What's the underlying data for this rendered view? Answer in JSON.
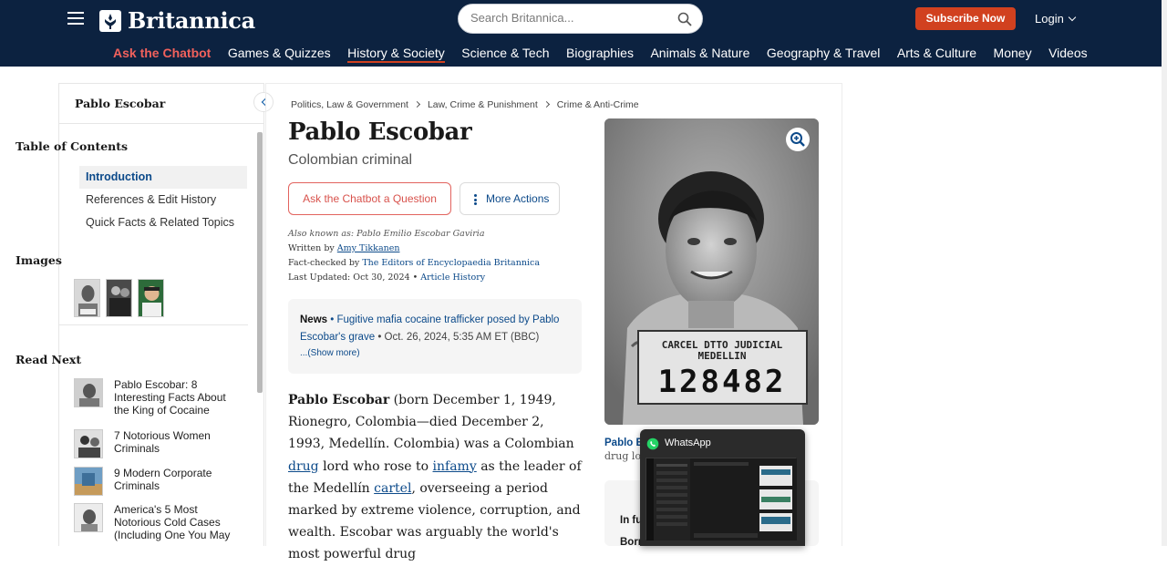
{
  "header": {
    "logo_text": "Britannica",
    "search_placeholder": "Search Britannica...",
    "subscribe_label": "Subscribe Now",
    "login_label": "Login",
    "nav": [
      {
        "label": "Ask the Chatbot"
      },
      {
        "label": "Games & Quizzes"
      },
      {
        "label": "History & Society"
      },
      {
        "label": "Science & Tech"
      },
      {
        "label": "Biographies"
      },
      {
        "label": "Animals & Nature"
      },
      {
        "label": "Geography & Travel"
      },
      {
        "label": "Arts & Culture"
      },
      {
        "label": "Money"
      },
      {
        "label": "Videos"
      }
    ],
    "active_nav": "History & Society",
    "accent_color": "#d1411f",
    "bg_color": "#0c2240"
  },
  "sidebar": {
    "title": "Pablo Escobar",
    "toc_heading": "Table of Contents",
    "toc": [
      {
        "label": "Introduction"
      },
      {
        "label": "References & Edit History"
      },
      {
        "label": "Quick Facts & Related Topics"
      }
    ],
    "images_heading": "Images",
    "read_next_heading": "Read Next",
    "read_next": [
      {
        "title": "Pablo Escobar: 8 Interesting Facts About the King of Cocaine"
      },
      {
        "title": "7 Notorious Women Criminals"
      },
      {
        "title": "9 Modern Corporate Criminals"
      },
      {
        "title": "America's 5 Most Notorious Cold Cases (Including One You May"
      }
    ]
  },
  "article": {
    "breadcrumbs": [
      "Politics, Law & Government",
      "Law, Crime & Punishment",
      "Crime & Anti-Crime"
    ],
    "title": "Pablo Escobar",
    "subtitle": "Colombian criminal",
    "ask_button": "Ask the Chatbot a Question",
    "more_button": "More Actions",
    "also_known_label": "Also known as:",
    "also_known_value": "Pablo Emilio Escobar Gaviria",
    "written_by_label": "Written by",
    "written_by": "Amy Tikkanen",
    "fact_checked_label": "Fact-checked by",
    "fact_checked_by": "The Editors of Encyclopaedia Britannica",
    "last_updated_label": "Last Updated:",
    "last_updated": "Oct 30, 2024",
    "bullet": "•",
    "article_history": "Article History",
    "news": {
      "label": "News",
      "bullet": "•",
      "headline": "Fugitive mafia cocaine trafficker posed by Pablo Escobar's grave",
      "date": "• Oct. 26, 2024, 5:35 AM ET (BBC)",
      "show_more": "...(Show more)"
    },
    "body": {
      "name": "Pablo Escobar",
      "p1": " (born December 1, 1949, Rionegro, Colombia—died December 2, 1993, Medellín. Colombia) was a Colombian ",
      "link1": "drug",
      "p2": " lord who rose to ",
      "link2": "infamy",
      "p3": " as the leader of the Medellín ",
      "link3": "cartel",
      "p4": ", overseeing a period marked by extreme violence, corruption, and wealth. Escobar was arguably the world's most powerful drug"
    }
  },
  "photo": {
    "placard_line1": "CARCEL DTTO JUDICIAL",
    "placard_line2": "MEDELLIN",
    "placard_number": "128482",
    "caption_title": "Pablo E",
    "caption_text": "drug lo",
    "side_card_l1": "In fu",
    "side_card_l2": "Born"
  },
  "popup": {
    "title": "WhatsApp"
  }
}
